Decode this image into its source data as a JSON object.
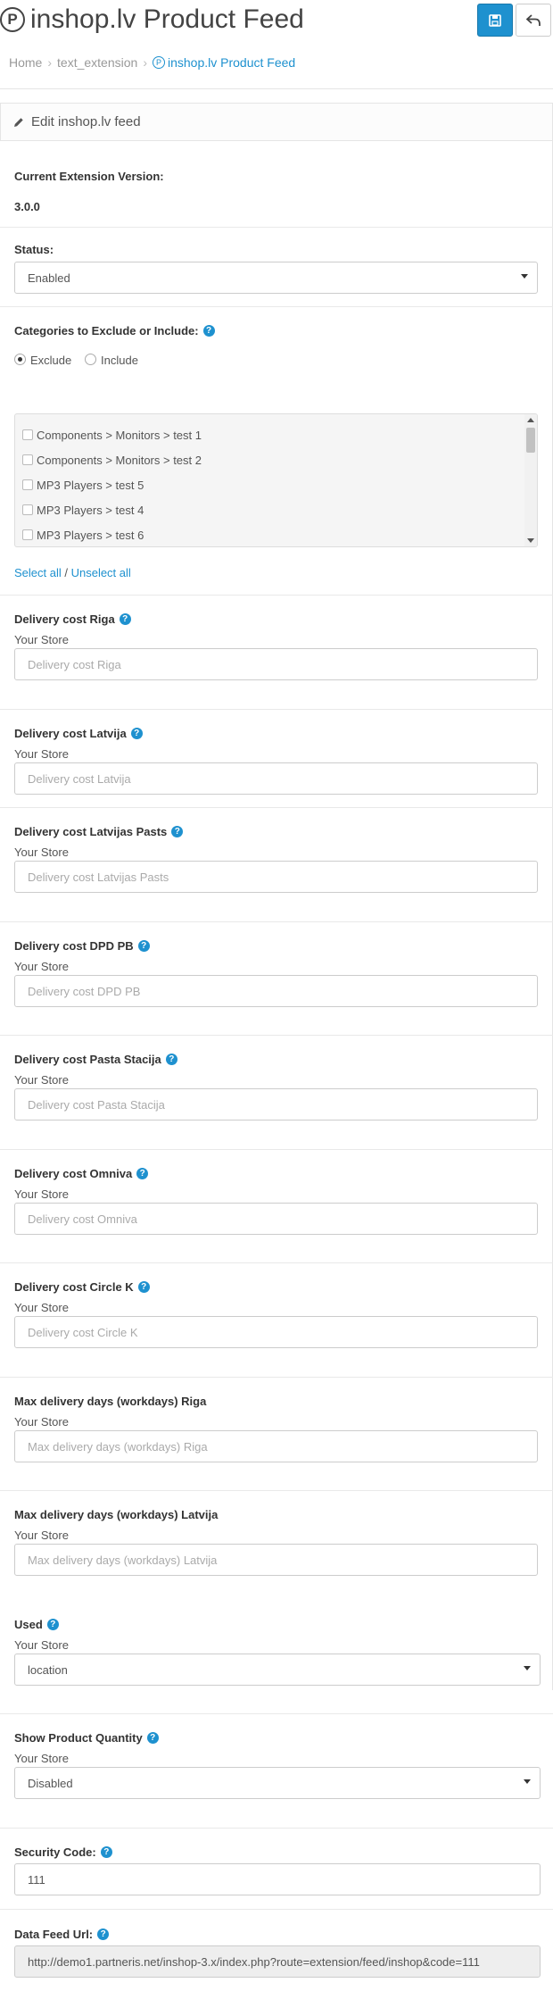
{
  "header": {
    "title": "inshop.lv Product Feed",
    "logo_letter": "P",
    "save_title": "Save",
    "back_title": "Cancel"
  },
  "breadcrumb": [
    "Home",
    "text_extension",
    "inshop.lv Product Feed"
  ],
  "panel": {
    "heading": "Edit inshop.lv feed"
  },
  "version": {
    "label": "Current Extension Version:",
    "value": "3.0.0"
  },
  "status": {
    "label": "Status:",
    "value": "Enabled"
  },
  "categories": {
    "label": "Categories to Exclude or Include:",
    "radio_exclude": "Exclude",
    "radio_include": "Include",
    "selected": "exclude",
    "items": [
      "Components  >  Monitors  >  test 1",
      "Components  >  Monitors  >  test 2",
      "MP3 Players  >  test 5",
      "MP3 Players  >  test 4",
      "MP3 Players  >  test 6"
    ],
    "select_all": "Select all",
    "separator": " / ",
    "unselect_all": "Unselect all"
  },
  "store_label": "Your Store",
  "fields": [
    {
      "label": "Delivery cost Riga",
      "placeholder": "Delivery cost Riga"
    },
    {
      "label": "Delivery cost Latvija",
      "placeholder": "Delivery cost Latvija"
    },
    {
      "label": "Delivery cost Latvijas Pasts",
      "placeholder": "Delivery cost Latvijas Pasts"
    },
    {
      "label": "Delivery cost DPD PB",
      "placeholder": "Delivery cost DPD PB"
    },
    {
      "label": "Delivery cost Pasta Stacija",
      "placeholder": "Delivery cost Pasta Stacija"
    },
    {
      "label": "Delivery cost Omniva",
      "placeholder": "Delivery cost Omniva"
    },
    {
      "label": "Delivery cost Circle K",
      "placeholder": "Delivery cost Circle K"
    },
    {
      "label": "Max delivery days (workdays) Riga",
      "placeholder": "Max delivery days (workdays) Riga"
    },
    {
      "label": "Max delivery days (workdays) Latvija",
      "placeholder": "Max delivery days (workdays) Latvija"
    }
  ],
  "used": {
    "label": "Used",
    "value": "location"
  },
  "show_quantity": {
    "label": "Show Product Quantity",
    "value": "Disabled"
  },
  "security": {
    "label": "Security Code:",
    "value": "111"
  },
  "feed_url": {
    "label": "Data Feed Url:",
    "value": "http://demo1.partneris.net/inshop-3.x/index.php?route=extension/feed/inshop&code=111"
  },
  "colors": {
    "primary": "#1e91cf",
    "border": "#cccccc",
    "muted": "#999999"
  }
}
